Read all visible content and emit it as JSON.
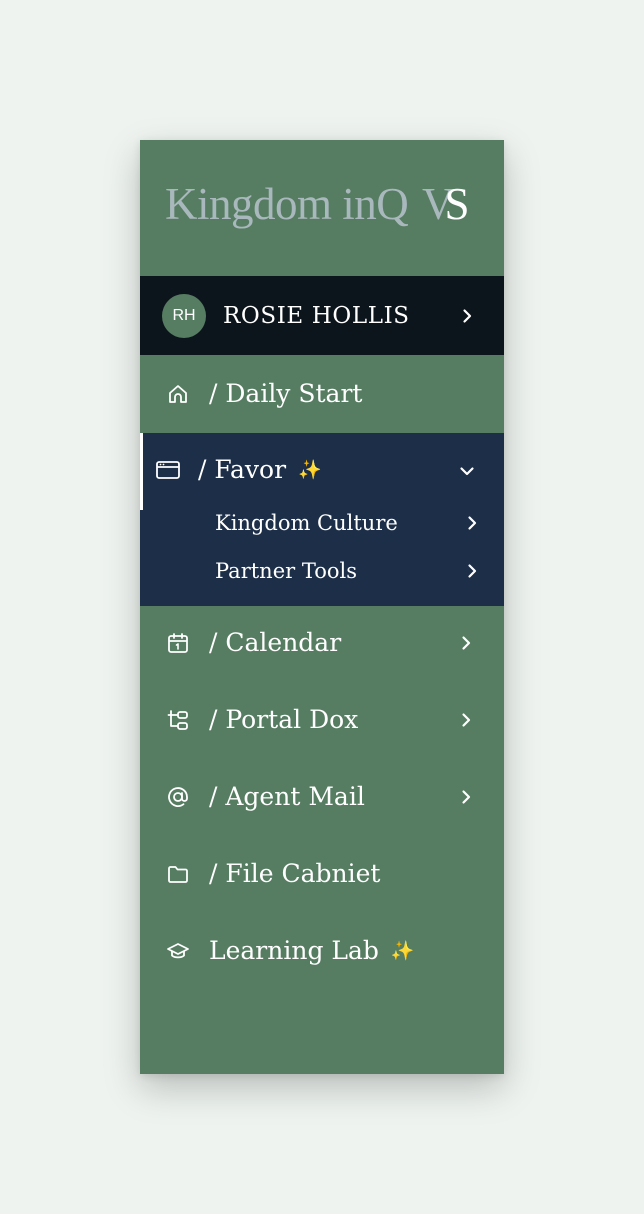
{
  "logo": {
    "text": "Kingdom inQ",
    "mark_v": "V",
    "mark_s": "S"
  },
  "user": {
    "initials": "RH",
    "name": "ROSIE HOLLIS"
  },
  "nav": {
    "daily_start": {
      "label": "/ Daily Start",
      "icon": "home-icon"
    },
    "favor": {
      "label": "/ Favor",
      "sparkle": "✨",
      "icon": "browser-window-icon",
      "expanded": true,
      "children": [
        {
          "label": "Kingdom Culture"
        },
        {
          "label": "Partner Tools"
        }
      ]
    },
    "calendar": {
      "label": "/ Calendar",
      "icon": "calendar-icon"
    },
    "portal_dox": {
      "label": "/ Portal Dox",
      "icon": "tree-structure-icon"
    },
    "agent_mail": {
      "label": "/ Agent Mail",
      "icon": "at-sign-icon"
    },
    "file_cabinet": {
      "label": "/ File Cabniet",
      "icon": "folder-icon"
    },
    "learning_lab": {
      "label": "Learning Lab",
      "sparkle": "✨",
      "icon": "graduation-cap-icon"
    }
  },
  "colors": {
    "sidebar_bg": "#567d62",
    "user_bar_bg": "#0d151c",
    "active_section_bg": "#1d2e48",
    "page_bg": "#eef3ef",
    "logo_gray": "#a9b8bc",
    "sparkle": "#f3d36a"
  }
}
